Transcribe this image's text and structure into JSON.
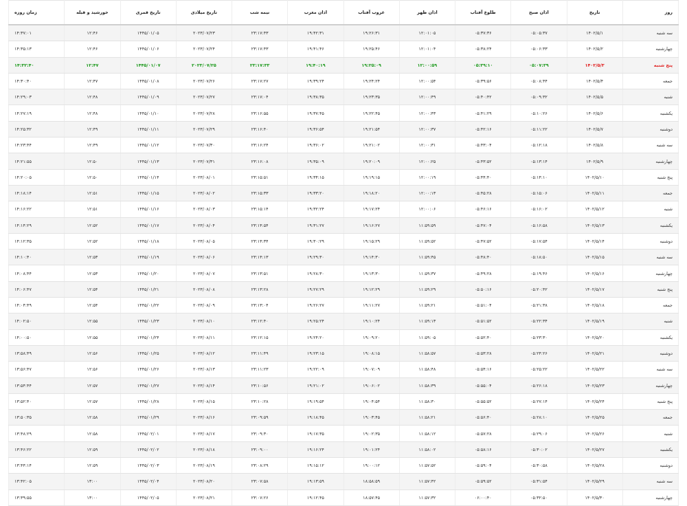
{
  "colors": {
    "today_text": "#1f9a1f",
    "today_day": "#e02020",
    "row_alt": "#f4f4f4",
    "border": "#e3e3e3"
  },
  "columns": [
    "روز",
    "تاریخ",
    "اذان صبح",
    "طلوع آفتاب",
    "اذان ظهر",
    "غروب آفتاب",
    "اذان مغرب",
    "نیمه شب",
    "تاریخ میلادی",
    "تاریخ قمری",
    "خورشید و قبله",
    "زمان روزه"
  ],
  "today_index": 2,
  "rows": [
    [
      "سه شنبه",
      "۱۴۰۲/۵/۱",
      "۰۵:۰۵:۳۷",
      "۰۵:۳۷:۳۶",
      "۱۲:۰۱:۰۵",
      "۱۹:۲۶:۳۱",
      "۱۹:۴۲:۳۱",
      "۲۳:۱۷:۴۳",
      "۲۰۲۳/۰۷/۲۳",
      "۱۴۴۵/۰۱/۰۵",
      "۱۲:۴۶",
      "۱۴:۳۷:۰۱"
    ],
    [
      "چهارشنبه",
      "۱۴۰۲/۵/۲",
      "۰۵:۰۶:۳۳",
      "۰۵:۳۸:۲۴",
      "۱۲:۰۱:۰۴",
      "۱۹:۲۵:۴۶",
      "۱۹:۴۱:۴۶",
      "۲۳:۱۷:۴۳",
      "۲۰۲۳/۰۷/۲۴",
      "۱۴۴۵/۰۱/۰۶",
      "۱۲:۴۶",
      "۱۴:۳۵:۱۳"
    ],
    [
      "پنج شنبه",
      "۱۴۰۲/۵/۳",
      "۰۵:۰۷:۳۹",
      "۰۵:۳۹:۱۰",
      "۱۲:۰۰:۵۹",
      "۱۹:۲۵:۰۹",
      "۱۹:۴۰:۱۹",
      "۲۳:۱۷:۳۳",
      "۲۰۲۳/۰۷/۲۵",
      "۱۴۴۵/۰۱/۰۷",
      "۱۲:۴۷",
      "۱۴:۳۲:۴۰"
    ],
    [
      "جمعه",
      "۱۴۰۲/۵/۴",
      "۰۵:۰۸:۴۴",
      "۰۵:۳۹:۵۶",
      "۱۲:۰۰:۵۴",
      "۱۹:۲۴:۲۴",
      "۱۹:۳۹:۲۴",
      "۲۳:۱۷:۲۷",
      "۲۰۲۳/۰۷/۲۶",
      "۱۴۴۵/۰۱/۰۸",
      "۱۲:۴۷",
      "۱۴:۳۰:۴۰"
    ],
    [
      "شنبه",
      "۱۴۰۲/۵/۵",
      "۰۵:۰۹:۳۲",
      "۰۵:۴۰:۴۲",
      "۱۲:۰۰:۴۹",
      "۱۹:۲۳:۳۵",
      "۱۹:۳۸:۳۵",
      "۲۳:۱۷:۰۴",
      "۲۰۲۳/۰۷/۲۷",
      "۱۴۴۵/۰۱/۰۹",
      "۱۲:۴۸",
      "۱۴:۲۹:۰۳"
    ],
    [
      "یکشنبه",
      "۱۴۰۲/۵/۶",
      "۰۵:۱۰:۲۶",
      "۰۵:۴۱:۲۹",
      "۱۲:۰۰:۴۳",
      "۱۹:۲۲:۴۵",
      "۱۹:۳۷:۴۵",
      "۲۳:۱۶:۵۵",
      "۲۰۲۳/۰۷/۲۸",
      "۱۴۴۵/۰۱/۱۰",
      "۱۲:۴۸",
      "۱۴:۲۷:۱۹"
    ],
    [
      "دوشنبه",
      "۱۴۰۲/۵/۷",
      "۰۵:۱۱:۲۲",
      "۰۵:۴۲:۱۶",
      "۱۲:۰۰:۳۷",
      "۱۹:۲۱:۵۴",
      "۱۹:۳۶:۵۴",
      "۲۳:۱۶:۴۰",
      "۲۰۲۳/۰۷/۲۹",
      "۱۴۴۵/۰۱/۱۱",
      "۱۲:۴۹",
      "۱۴:۲۵:۳۲"
    ],
    [
      "سه شنبه",
      "۱۴۰۲/۵/۸",
      "۰۵:۱۲:۱۸",
      "۰۵:۴۳:۰۴",
      "۱۲:۰۰:۳۱",
      "۱۹:۲۱:۰۲",
      "۱۹:۳۶:۰۲",
      "۲۳:۱۶:۲۴",
      "۲۰۲۳/۰۷/۳۰",
      "۱۴۴۵/۰۱/۱۲",
      "۱۲:۴۹",
      "۱۴:۲۳:۴۴"
    ],
    [
      "چهارشنبه",
      "۱۴۰۲/۵/۹",
      "۰۵:۱۳:۱۴",
      "۰۵:۴۳:۵۲",
      "۱۲:۰۰:۲۵",
      "۱۹:۲۰:۰۹",
      "۱۹:۳۵:۰۹",
      "۲۳:۱۶:۰۸",
      "۲۰۲۳/۰۷/۳۱",
      "۱۴۴۵/۰۱/۱۳",
      "۱۲:۵۰",
      "۱۴:۲۱:۵۵"
    ],
    [
      "پنج شنبه",
      "۱۴۰۲/۵/۱۰",
      "۰۵:۱۴:۱۰",
      "۰۵:۴۴:۴۰",
      "۱۲:۰۰:۱۹",
      "۱۹:۱۹:۱۵",
      "۱۹:۳۴:۱۵",
      "۲۳:۱۵:۵۱",
      "۲۰۲۳/۰۸/۰۱",
      "۱۴۴۵/۰۱/۱۴",
      "۱۲:۵۰",
      "۱۴:۲۰:۰۵"
    ],
    [
      "جمعه",
      "۱۴۰۲/۵/۱۱",
      "۰۵:۱۵:۰۶",
      "۰۵:۴۵:۲۸",
      "۱۲:۰۰:۱۳",
      "۱۹:۱۸:۲۰",
      "۱۹:۳۳:۲۰",
      "۲۳:۱۵:۳۳",
      "۲۰۲۳/۰۸/۰۲",
      "۱۴۴۵/۰۱/۱۵",
      "۱۲:۵۱",
      "۱۴:۱۸:۱۴"
    ],
    [
      "شنبه",
      "۱۴۰۲/۵/۱۲",
      "۰۵:۱۶:۰۲",
      "۰۵:۴۶:۱۶",
      "۱۲:۰۰:۰۶",
      "۱۹:۱۷:۲۴",
      "۱۹:۳۲:۲۴",
      "۲۳:۱۵:۱۴",
      "۲۰۲۳/۰۸/۰۳",
      "۱۴۴۵/۰۱/۱۶",
      "۱۲:۵۱",
      "۱۴:۱۶:۲۲"
    ],
    [
      "یکشنبه",
      "۱۴۰۲/۵/۱۳",
      "۰۵:۱۶:۵۸",
      "۰۵:۴۷:۰۴",
      "۱۱:۵۹:۵۹",
      "۱۹:۱۶:۲۷",
      "۱۹:۳۱:۲۷",
      "۲۳:۱۴:۵۴",
      "۲۰۲۳/۰۸/۰۴",
      "۱۴۴۵/۰۱/۱۷",
      "۱۲:۵۲",
      "۱۴:۱۴:۲۹"
    ],
    [
      "دوشنبه",
      "۱۴۰۲/۵/۱۴",
      "۰۵:۱۷:۵۴",
      "۰۵:۴۷:۵۲",
      "۱۱:۵۹:۵۲",
      "۱۹:۱۵:۲۹",
      "۱۹:۳۰:۲۹",
      "۲۳:۱۴:۳۴",
      "۲۰۲۳/۰۸/۰۵",
      "۱۴۴۵/۰۱/۱۸",
      "۱۲:۵۲",
      "۱۴:۱۲:۳۵"
    ],
    [
      "سه شنبه",
      "۱۴۰۲/۵/۱۵",
      "۰۵:۱۸:۵۰",
      "۰۵:۴۸:۴۰",
      "۱۱:۵۹:۴۵",
      "۱۹:۱۴:۳۰",
      "۱۹:۲۹:۳۰",
      "۲۳:۱۴:۱۳",
      "۲۰۲۳/۰۸/۰۶",
      "۱۴۴۵/۰۱/۱۹",
      "۱۲:۵۳",
      "۱۴:۱۰:۴۰"
    ],
    [
      "چهارشنبه",
      "۱۴۰۲/۵/۱۶",
      "۰۵:۱۹:۴۶",
      "۰۵:۴۹:۲۸",
      "۱۱:۵۹:۳۷",
      "۱۹:۱۳:۳۰",
      "۱۹:۲۸:۳۰",
      "۲۳:۱۳:۵۱",
      "۲۰۲۳/۰۸/۰۷",
      "۱۴۴۵/۰۱/۲۰",
      "۱۲:۵۳",
      "۱۴:۰۸:۴۴"
    ],
    [
      "پنج شنبه",
      "۱۴۰۲/۵/۱۷",
      "۰۵:۲۰:۴۲",
      "۰۵:۵۰:۱۶",
      "۱۱:۵۹:۲۹",
      "۱۹:۱۲:۲۹",
      "۱۹:۲۷:۲۹",
      "۲۳:۱۳:۲۸",
      "۲۰۲۳/۰۸/۰۸",
      "۱۴۴۵/۰۱/۲۱",
      "۱۲:۵۴",
      "۱۴:۰۶:۴۷"
    ],
    [
      "جمعه",
      "۱۴۰۲/۵/۱۸",
      "۰۵:۲۱:۳۸",
      "۰۵:۵۱:۰۴",
      "۱۱:۵۹:۲۱",
      "۱۹:۱۱:۲۷",
      "۱۹:۲۶:۲۷",
      "۲۳:۱۳:۰۴",
      "۲۰۲۳/۰۸/۰۹",
      "۱۴۴۵/۰۱/۲۲",
      "۱۲:۵۴",
      "۱۴:۰۴:۴۹"
    ],
    [
      "شنبه",
      "۱۴۰۲/۵/۱۹",
      "۰۵:۲۲:۳۴",
      "۰۵:۵۱:۵۲",
      "۱۱:۵۹:۱۳",
      "۱۹:۱۰:۲۴",
      "۱۹:۲۵:۲۴",
      "۲۳:۱۲:۴۰",
      "۲۰۲۳/۰۸/۱۰",
      "۱۴۴۵/۰۱/۲۳",
      "۱۲:۵۵",
      "۱۴:۰۲:۵۰"
    ],
    [
      "یکشنبه",
      "۱۴۰۲/۵/۲۰",
      "۰۵:۲۳:۳۰",
      "۰۵:۵۲:۴۰",
      "۱۱:۵۹:۰۵",
      "۱۹:۰۹:۲۰",
      "۱۹:۲۴:۲۰",
      "۲۳:۱۲:۱۵",
      "۲۰۲۳/۰۸/۱۱",
      "۱۴۴۵/۰۱/۲۴",
      "۱۲:۵۵",
      "۱۴:۰۰:۵۰"
    ],
    [
      "دوشنبه",
      "۱۴۰۲/۵/۲۱",
      "۰۵:۲۴:۲۶",
      "۰۵:۵۳:۲۸",
      "۱۱:۵۸:۵۷",
      "۱۹:۰۸:۱۵",
      "۱۹:۲۳:۱۵",
      "۲۳:۱۱:۴۹",
      "۲۰۲۳/۰۸/۱۲",
      "۱۴۴۵/۰۱/۲۵",
      "۱۲:۵۶",
      "۱۳:۵۸:۴۹"
    ],
    [
      "سه شنبه",
      "۱۴۰۲/۵/۲۲",
      "۰۵:۲۵:۲۲",
      "۰۵:۵۴:۱۶",
      "۱۱:۵۸:۴۸",
      "۱۹:۰۷:۰۹",
      "۱۹:۲۲:۰۹",
      "۲۳:۱۱:۲۳",
      "۲۰۲۳/۰۸/۱۳",
      "۱۴۴۵/۰۱/۲۶",
      "۱۲:۵۶",
      "۱۳:۵۶:۴۷"
    ],
    [
      "چهارشنبه",
      "۱۴۰۲/۵/۲۳",
      "۰۵:۲۶:۱۸",
      "۰۵:۵۵:۰۴",
      "۱۱:۵۸:۳۹",
      "۱۹:۰۶:۰۲",
      "۱۹:۲۱:۰۲",
      "۲۳:۱۰:۵۶",
      "۲۰۲۳/۰۸/۱۴",
      "۱۴۴۵/۰۱/۲۷",
      "۱۲:۵۷",
      "۱۳:۵۴:۴۴"
    ],
    [
      "پنج شنبه",
      "۱۴۰۲/۵/۲۴",
      "۰۵:۲۷:۱۴",
      "۰۵:۵۵:۵۲",
      "۱۱:۵۸:۳۰",
      "۱۹:۰۴:۵۴",
      "۱۹:۱۹:۵۴",
      "۲۳:۱۰:۲۸",
      "۲۰۲۳/۰۸/۱۵",
      "۱۴۴۵/۰۱/۲۸",
      "۱۲:۵۷",
      "۱۳:۵۲:۴۰"
    ],
    [
      "جمعه",
      "۱۴۰۲/۵/۲۵",
      "۰۵:۲۸:۱۰",
      "۰۵:۵۶:۴۰",
      "۱۱:۵۸:۲۱",
      "۱۹:۰۳:۴۵",
      "۱۹:۱۸:۴۵",
      "۲۳:۰۹:۵۹",
      "۲۰۲۳/۰۸/۱۶",
      "۱۴۴۵/۰۱/۲۹",
      "۱۲:۵۸",
      "۱۳:۵۰:۳۵"
    ],
    [
      "شنبه",
      "۱۴۰۲/۵/۲۶",
      "۰۵:۲۹:۰۶",
      "۰۵:۵۷:۲۸",
      "۱۱:۵۸:۱۲",
      "۱۹:۰۲:۳۵",
      "۱۹:۱۷:۳۵",
      "۲۳:۰۹:۳۰",
      "۲۰۲۳/۰۸/۱۷",
      "۱۴۴۵/۰۲/۰۱",
      "۱۲:۵۸",
      "۱۳:۴۸:۲۹"
    ],
    [
      "یکشنبه",
      "۱۴۰۲/۵/۲۷",
      "۰۵:۳۰:۰۲",
      "۰۵:۵۸:۱۶",
      "۱۱:۵۸:۰۲",
      "۱۹:۰۱:۲۴",
      "۱۹:۱۶:۲۴",
      "۲۳:۰۹:۰۰",
      "۲۰۲۳/۰۸/۱۸",
      "۱۴۴۵/۰۲/۰۲",
      "۱۲:۵۹",
      "۱۳:۴۶:۲۲"
    ],
    [
      "دوشنبه",
      "۱۴۰۲/۵/۲۸",
      "۰۵:۳۰:۵۸",
      "۰۵:۵۹:۰۴",
      "۱۱:۵۷:۵۲",
      "۱۹:۰۰:۱۲",
      "۱۹:۱۵:۱۲",
      "۲۳:۰۸:۲۹",
      "۲۰۲۳/۰۸/۱۹",
      "۱۴۴۵/۰۲/۰۳",
      "۱۲:۵۹",
      "۱۳:۴۴:۱۴"
    ],
    [
      "سه شنبه",
      "۱۴۰۲/۵/۲۹",
      "۰۵:۳۱:۵۴",
      "۰۵:۵۹:۵۲",
      "۱۱:۵۷:۴۲",
      "۱۸:۵۸:۵۹",
      "۱۹:۱۳:۵۹",
      "۲۳:۰۷:۵۸",
      "۲۰۲۳/۰۸/۲۰",
      "۱۴۴۵/۰۲/۰۴",
      "۱۳:۰۰",
      "۱۳:۴۲:۰۵"
    ],
    [
      "چهارشنبه",
      "۱۴۰۲/۵/۳۰",
      "۰۵:۳۲:۵۰",
      "۰۶:۰۰:۴۰",
      "۱۱:۵۷:۳۲",
      "۱۸:۵۷:۴۵",
      "۱۹:۱۲:۴۵",
      "۲۳:۰۷:۲۶",
      "۲۰۲۳/۰۸/۲۱",
      "۱۴۴۵/۰۲/۰۵",
      "۱۳:۰۰",
      "۱۳:۳۹:۵۵"
    ]
  ]
}
